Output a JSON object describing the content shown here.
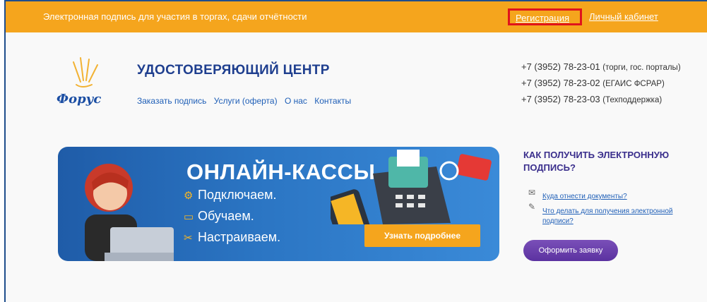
{
  "topbar": {
    "tagline": "Электронная подпись для участия в торгах, сдачи отчётности",
    "register_link": "Регистрация",
    "cabinet_link": "Личный кабинет"
  },
  "brand": {
    "logo_text": "Форус",
    "title": "УДОСТОВЕРЯЮЩИЙ ЦЕНТР"
  },
  "nav": {
    "items": [
      "Заказать подпись",
      "Услуги (оферта)",
      "О нас",
      "Контакты"
    ]
  },
  "phones": [
    {
      "number": "+7 (3952) 78-23-01",
      "note": "(торги, гос. порталы)"
    },
    {
      "number": "+7 (3952) 78-23-02",
      "note": "(ЕГАИС ФСРАР)"
    },
    {
      "number": "+7 (3952) 78-23-03",
      "note": "(Техподдержка)"
    }
  ],
  "banner": {
    "title": "ОНЛАЙН-КАССЫ",
    "items": [
      "Подключаем.",
      "Обучаем.",
      "Настраиваем."
    ],
    "button": "Узнать подробнее"
  },
  "sidebar": {
    "title": "КАК ПОЛУЧИТЬ ЭЛЕКТРОННУЮ ПОДПИСЬ?",
    "links": [
      "Куда отнести документы?",
      "Что делать для получения электронной подписи?"
    ],
    "order_button": "Оформить заявку"
  },
  "colors": {
    "topbar": "#f5a51d",
    "highlight_border": "#e0141c",
    "brand_blue": "#1f3f8f",
    "link_blue": "#1f5fb7",
    "order_purple": "#5b32a0"
  }
}
